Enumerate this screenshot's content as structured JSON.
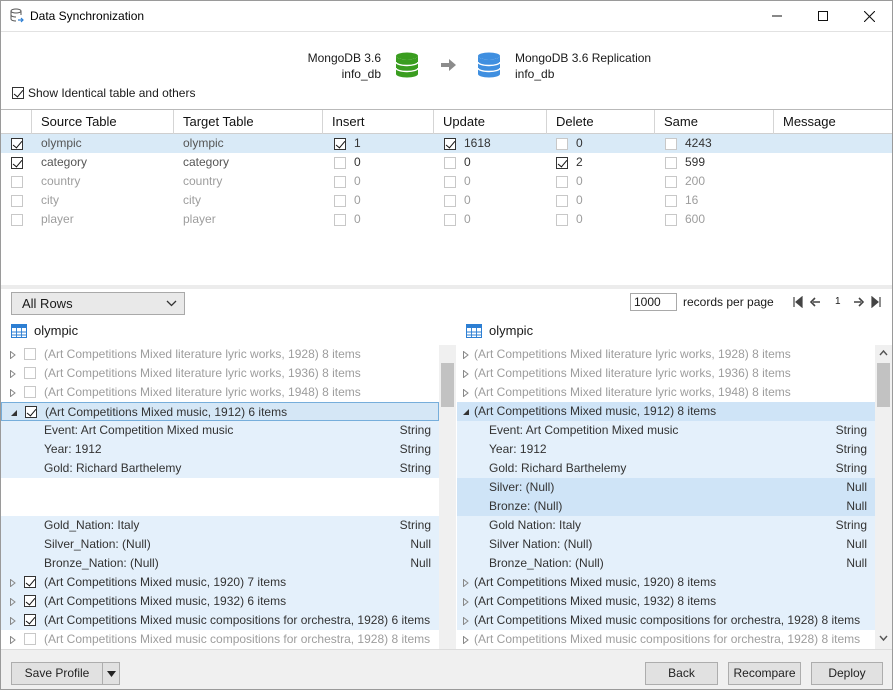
{
  "window": {
    "title": "Data Synchronization"
  },
  "header": {
    "source_type": "MongoDB 3.6",
    "source_db": "info_db",
    "target_type": "MongoDB 3.6 Replication",
    "target_db": "info_db",
    "show_identical_label": "Show Identical table and others",
    "show_identical_checked": true
  },
  "grid": {
    "columns": [
      "Source Table",
      "Target Table",
      "Insert",
      "Update",
      "Delete",
      "Same",
      "Message"
    ],
    "rows": [
      {
        "checked": true,
        "source": "olympic",
        "target": "olympic",
        "insert_checked": true,
        "insert": "1",
        "update_checked": true,
        "update": "1618",
        "delete_checked": false,
        "delete": "0",
        "same": "4243",
        "message": "",
        "selected": true,
        "dim": false
      },
      {
        "checked": true,
        "source": "category",
        "target": "category",
        "insert_checked": false,
        "insert": "0",
        "update_checked": false,
        "update": "0",
        "delete_checked": true,
        "delete": "2",
        "same": "599",
        "message": "",
        "selected": false,
        "dim": false
      },
      {
        "checked": false,
        "source": "country",
        "target": "country",
        "insert_checked": false,
        "insert": "0",
        "update_checked": false,
        "update": "0",
        "delete_checked": false,
        "delete": "0",
        "same": "200",
        "message": "",
        "selected": false,
        "dim": true
      },
      {
        "checked": false,
        "source": "city",
        "target": "city",
        "insert_checked": false,
        "insert": "0",
        "update_checked": false,
        "update": "0",
        "delete_checked": false,
        "delete": "0",
        "same": "16",
        "message": "",
        "selected": false,
        "dim": true
      },
      {
        "checked": false,
        "source": "player",
        "target": "player",
        "insert_checked": false,
        "insert": "0",
        "update_checked": false,
        "update": "0",
        "delete_checked": false,
        "delete": "0",
        "same": "600",
        "message": "",
        "selected": false,
        "dim": true
      }
    ]
  },
  "controls": {
    "filter_value": "All Rows",
    "records_per_page": "1000",
    "records_label": "records per page",
    "page": "1"
  },
  "left_pane": {
    "title": "olympic",
    "rows": [
      {
        "kind": "group",
        "tri": "closed",
        "cb": "dim",
        "text": "(Art Competitions Mixed literature lyric works, 1928) 8 items",
        "style": "dim",
        "bg": "none"
      },
      {
        "kind": "group",
        "tri": "closed",
        "cb": "dim",
        "text": "(Art Competitions Mixed literature lyric works, 1936) 8 items",
        "style": "dim",
        "bg": "none"
      },
      {
        "kind": "group",
        "tri": "closed",
        "cb": "dim",
        "text": "(Art Competitions Mixed literature lyric works, 1948) 8 items",
        "style": "dim",
        "bg": "none"
      },
      {
        "kind": "group",
        "tri": "open",
        "cb": "on",
        "text": "(Art Competitions Mixed music, 1912) 6 items",
        "style": "norm",
        "bg": "focus"
      },
      {
        "kind": "field",
        "text": "Event: Art Competition Mixed music",
        "type": "String",
        "bg": "blue"
      },
      {
        "kind": "field",
        "text": "Year: 1912",
        "type": "String",
        "bg": "blue"
      },
      {
        "kind": "field",
        "text": "Gold: Richard Barthelemy",
        "type": "String",
        "bg": "blue"
      },
      {
        "kind": "empty",
        "bg": "white"
      },
      {
        "kind": "empty",
        "bg": "white"
      },
      {
        "kind": "field",
        "text": "Gold_Nation: Italy",
        "type": "String",
        "bg": "blue"
      },
      {
        "kind": "field",
        "text": "Silver_Nation: (Null)",
        "type": "Null",
        "bg": "blue"
      },
      {
        "kind": "field",
        "text": "Bronze_Nation: (Null)",
        "type": "Null",
        "bg": "blue"
      },
      {
        "kind": "group",
        "tri": "closed",
        "cb": "on",
        "text": "(Art Competitions Mixed music, 1920) 7 items",
        "style": "norm",
        "bg": "blue"
      },
      {
        "kind": "group",
        "tri": "closed",
        "cb": "on",
        "text": "(Art Competitions Mixed music, 1932) 6 items",
        "style": "norm",
        "bg": "blue"
      },
      {
        "kind": "group",
        "tri": "closed",
        "cb": "on",
        "text": "(Art Competitions Mixed music compositions for orchestra, 1928) 6 items",
        "style": "norm",
        "bg": "blue"
      },
      {
        "kind": "group",
        "tri": "closed",
        "cb": "dim",
        "text": "(Art Competitions Mixed music compositions for orchestra, 1928) 8 items",
        "style": "dim",
        "bg": "none"
      }
    ]
  },
  "right_pane": {
    "title": "olympic",
    "rows": [
      {
        "kind": "group",
        "tri": "closed",
        "text": "(Art Competitions Mixed literature lyric works, 1928) 8 items",
        "style": "dim",
        "bg": "none"
      },
      {
        "kind": "group",
        "tri": "closed",
        "text": "(Art Competitions Mixed literature lyric works, 1936) 8 items",
        "style": "dim",
        "bg": "none"
      },
      {
        "kind": "group",
        "tri": "closed",
        "text": "(Art Competitions Mixed literature lyric works, 1948) 8 items",
        "style": "dim",
        "bg": "none"
      },
      {
        "kind": "group",
        "tri": "open",
        "text": "(Art Competitions Mixed music, 1912) 8 items",
        "style": "norm",
        "bg": "sel"
      },
      {
        "kind": "field",
        "text": "Event: Art Competition Mixed music",
        "type": "String",
        "bg": "blue"
      },
      {
        "kind": "field",
        "text": "Year: 1912",
        "type": "String",
        "bg": "blue"
      },
      {
        "kind": "field",
        "text": "Gold: Richard Barthelemy",
        "type": "String",
        "bg": "blue"
      },
      {
        "kind": "field",
        "text": "Silver: (Null)",
        "type": "Null",
        "bg": "strong"
      },
      {
        "kind": "field",
        "text": "Bronze: (Null)",
        "type": "Null",
        "bg": "strong"
      },
      {
        "kind": "field",
        "text": "Gold Nation: Italy",
        "type": "String",
        "bg": "blue"
      },
      {
        "kind": "field",
        "text": "Silver Nation: (Null)",
        "type": "Null",
        "bg": "blue"
      },
      {
        "kind": "field",
        "text": "Bronze_Nation: (Null)",
        "type": "Null",
        "bg": "blue"
      },
      {
        "kind": "group",
        "tri": "closed",
        "text": "(Art Competitions Mixed music, 1920) 8 items",
        "style": "norm",
        "bg": "blue"
      },
      {
        "kind": "group",
        "tri": "closed",
        "text": "(Art Competitions Mixed music, 1932) 8 items",
        "style": "norm",
        "bg": "blue"
      },
      {
        "kind": "group",
        "tri": "closed",
        "text": "(Art Competitions Mixed music compositions for orchestra, 1928) 8 items",
        "style": "norm",
        "bg": "blue"
      },
      {
        "kind": "group",
        "tri": "closed",
        "text": "(Art Competitions Mixed music compositions for orchestra, 1928) 8 items",
        "style": "dim",
        "bg": "none"
      }
    ]
  },
  "footer": {
    "save_profile": "Save Profile",
    "back": "Back",
    "recompare": "Recompare",
    "deploy": "Deploy"
  },
  "colors": {
    "source_db": "#3a9d1f",
    "target_db": "#3f8fe0",
    "selection": "#d9eaf7",
    "changed_row": "#e4f0fb"
  },
  "icons": [
    "app-sync-icon",
    "minimize-icon",
    "maximize-icon",
    "close-icon",
    "database-icon",
    "arrow-right-icon",
    "table-icon",
    "chevron-down-icon",
    "first-page-icon",
    "prev-page-icon",
    "next-page-icon",
    "last-page-icon",
    "expand-icon",
    "collapse-icon",
    "scroll-up-icon",
    "scroll-down-icon"
  ]
}
